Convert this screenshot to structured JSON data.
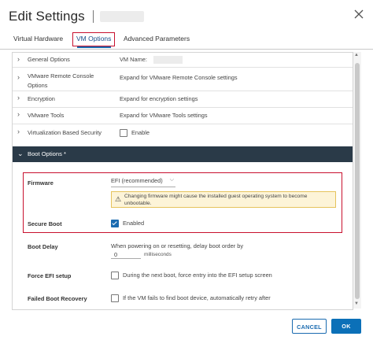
{
  "dialog": {
    "title": "Edit Settings",
    "tabs": [
      {
        "label": "Virtual Hardware"
      },
      {
        "label": "VM Options"
      },
      {
        "label": "Advanced Parameters"
      }
    ]
  },
  "rows": [
    {
      "label": "General Options",
      "value": "VM Name:"
    },
    {
      "label": "VMware Remote Console Options",
      "value": "Expand for VMware Remote Console settings"
    },
    {
      "label": "Encryption",
      "value": "Expand for encryption settings"
    },
    {
      "label": "VMware Tools",
      "value": "Expand for VMware Tools settings"
    },
    {
      "label": "Virtualization Based Security",
      "value": "Enable"
    }
  ],
  "boot": {
    "header": "Boot Options *",
    "firmware": {
      "label": "Firmware",
      "value": "EFI (recommended)",
      "warning": "Changing firmware might cause the installed guest operating system to become unbootable."
    },
    "secure_boot": {
      "label": "Secure Boot",
      "value": "Enabled",
      "checked": true
    },
    "boot_delay": {
      "label": "Boot Delay",
      "text": "When powering on or resetting, delay boot order by",
      "value": "0",
      "unit": "milliseconds"
    },
    "force_efi": {
      "label": "Force EFI setup",
      "text": "During the next boot, force entry into the EFI setup screen"
    },
    "failed_recovery": {
      "label": "Failed Boot Recovery",
      "text": "If the VM fails to find boot device, automatically retry after"
    }
  },
  "footer": {
    "cancel": "CANCEL",
    "ok": "OK"
  },
  "colors": {
    "accent": "#0b70b8",
    "highlight": "#c8102e",
    "header_bg": "#2a3a48",
    "warning_bg": "#fdf4d8"
  }
}
